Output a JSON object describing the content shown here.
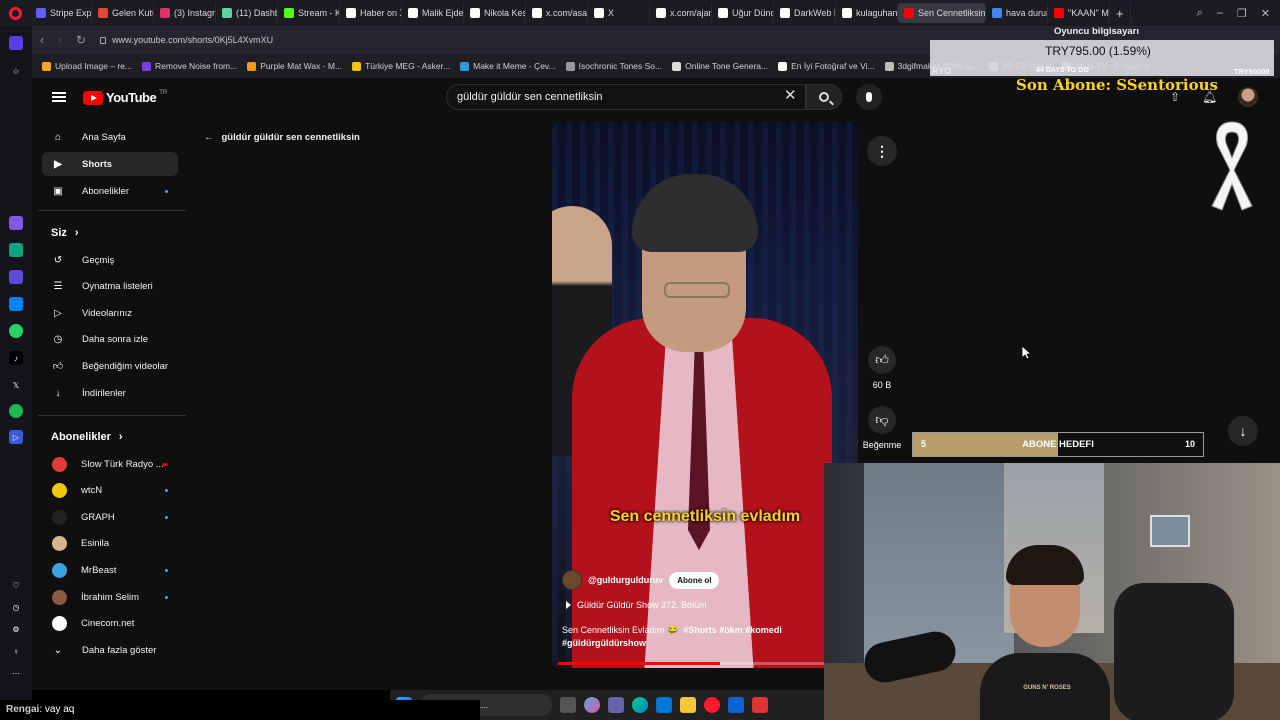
{
  "browser": {
    "tabs": [
      {
        "label": "Stripe Expr",
        "color": "#635bff"
      },
      {
        "label": "Gelen Kutu",
        "color": "#ea4335"
      },
      {
        "label": "(3) Instagra",
        "color": "#e1306c"
      },
      {
        "label": "(11) Dashb",
        "color": "#5fd3a5"
      },
      {
        "label": "Stream - Ki",
        "color": "#53fc18"
      },
      {
        "label": "Haber on X",
        "color": "#ffffff"
      },
      {
        "label": "Malik Ejder",
        "color": "#ffffff"
      },
      {
        "label": "Nikola Kes",
        "color": "#ffffff"
      },
      {
        "label": "x.com/asay",
        "color": "#ffffff"
      },
      {
        "label": "X",
        "color": "#ffffff"
      },
      {
        "label": "x.com/ajan",
        "color": "#ffffff"
      },
      {
        "label": "Uğur Dünd",
        "color": "#ffffff"
      },
      {
        "label": "DarkWeb H",
        "color": "#ffffff"
      },
      {
        "label": "kulaguhan",
        "color": "#ffffff"
      },
      {
        "label": "Sen Cennetliksin",
        "color": "#ff0000",
        "active": true
      },
      {
        "label": "hava durum",
        "color": "#4285f4"
      },
      {
        "label": "\"KAAN\" Me",
        "color": "#ff0000"
      }
    ],
    "new_tab": "+",
    "url": "www.youtube.com/shorts/0Kj5L4XvmXU",
    "bookmarks": [
      {
        "label": "Upload Image – re...",
        "color": "#f5a623"
      },
      {
        "label": "Remove Noise from...",
        "color": "#7b3fe4"
      },
      {
        "label": "Purple Mat Wax - M...",
        "color": "#f39c12"
      },
      {
        "label": "Türkiye MEG - Asker...",
        "color": "#f1c40f"
      },
      {
        "label": "Make it Meme - Çev...",
        "color": "#3498db"
      },
      {
        "label": "Isochronic Tones So...",
        "color": "#999999"
      },
      {
        "label": "Online Tone Genera...",
        "color": "#dddddd"
      },
      {
        "label": "En İyi Fotoğraf ve Vi...",
        "color": "#ffffff"
      },
      {
        "label": "3dgifmaker28349.gi...",
        "color": "#bbbbbb"
      },
      {
        "label": "3D Gif Maker",
        "color": "#bbbbbb"
      },
      {
        "label": "Multi TV - 5 haber k...",
        "color": "#bbbbbb"
      }
    ]
  },
  "youtube": {
    "logo_text": "YouTube",
    "country": "TR",
    "search_query": "güldür güldür sen cennetliksin",
    "back_label": "güldür güldür sen cennetliksin",
    "sidebar": {
      "main": [
        {
          "label": "Ana Sayfa",
          "icon": "home-icon"
        },
        {
          "label": "Shorts",
          "icon": "shorts-icon",
          "active": true
        },
        {
          "label": "Abonelikler",
          "icon": "subscriptions-icon",
          "dot": true
        }
      ],
      "you_title": "Siz",
      "you": [
        {
          "label": "Geçmiş",
          "icon": "history-icon"
        },
        {
          "label": "Oynatma listeleri",
          "icon": "playlist-icon"
        },
        {
          "label": "Videolarınız",
          "icon": "your-videos-icon"
        },
        {
          "label": "Daha sonra izle",
          "icon": "watch-later-icon"
        },
        {
          "label": "Beğendiğim videolar",
          "icon": "liked-icon"
        },
        {
          "label": "İndirilenler",
          "icon": "download-icon"
        }
      ],
      "subs_title": "Abonelikler",
      "subs": [
        {
          "label": "Slow Türk Radyo ...",
          "color": "#e23b3b",
          "live": true
        },
        {
          "label": "wtcN",
          "color": "#f0c808",
          "dot": true
        },
        {
          "label": "GRAPH",
          "color": "#222222",
          "dot": true
        },
        {
          "label": "Esinila",
          "color": "#d9b38c"
        },
        {
          "label": "MrBeast",
          "color": "#3aa3e0",
          "dot": true
        },
        {
          "label": "İbrahim Selim",
          "color": "#8a5a44",
          "dot": true
        },
        {
          "label": "Cinecom.net",
          "color": "#ffffff"
        }
      ],
      "show_more": "Daha fazla göster"
    },
    "video": {
      "caption": "Sen cennetliksin evladım",
      "channel": "@guldurgulduruv",
      "subscribe": "Abone ol",
      "episode": "Güldür Güldür Show 372. Bölüm",
      "description": "Sen Cennetliksin Evladım 😂",
      "hashtags": "#Shorts #bkm #komedi",
      "hashtag2": "#güldürgüldürshow",
      "progress": 0.55
    },
    "actions": {
      "more": "⋮",
      "like_count": "60 B",
      "dislike_label": "Beğenme"
    }
  },
  "overlays": {
    "pc_label": "Oyuncu bilgisayarı",
    "stock_value": "TRY795.00 (1.59%)",
    "stock_left": "RYO",
    "stock_days": "44 DAYS TO GO",
    "stock_right": "TRY50000",
    "son_abone": "Son Abone: SSentorious",
    "goal": {
      "start": "5",
      "title": "ABONE HEDEFI",
      "end": "10",
      "progress": 0.5
    },
    "shirt_text": "GUNS N' ROSES"
  },
  "chat": {
    "user": "Rengai",
    "message": ": vay aq"
  },
  "taskbar": {
    "search_label": "Web'de &..."
  }
}
